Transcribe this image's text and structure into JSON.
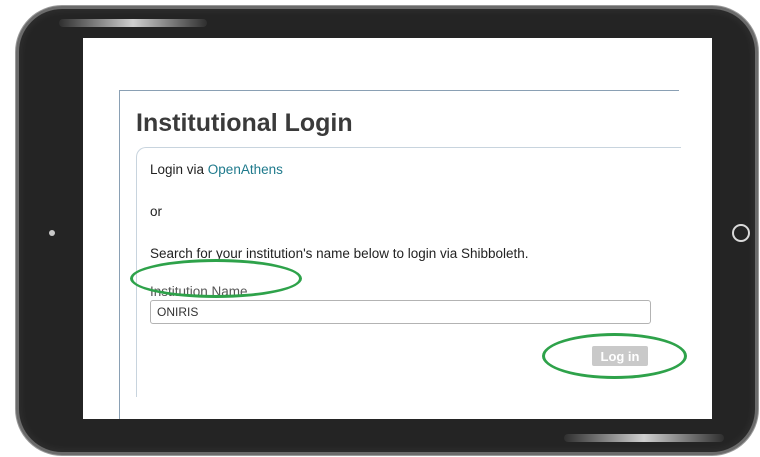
{
  "login": {
    "title": "Institutional Login",
    "via_prefix": "Login via ",
    "openathens_link": "OpenAthens",
    "or_text": "or",
    "shibboleth_text": "Search for your institution's name below to login via Shibboleth.",
    "institution_label": "Institution Name",
    "institution_value": "ONIRIS",
    "login_button": "Log in"
  },
  "colors": {
    "link": "#1f7a8c",
    "highlight_oval": "#2ea24a",
    "button_bg": "#c9c9c9",
    "tablet_frame": "#242424"
  }
}
